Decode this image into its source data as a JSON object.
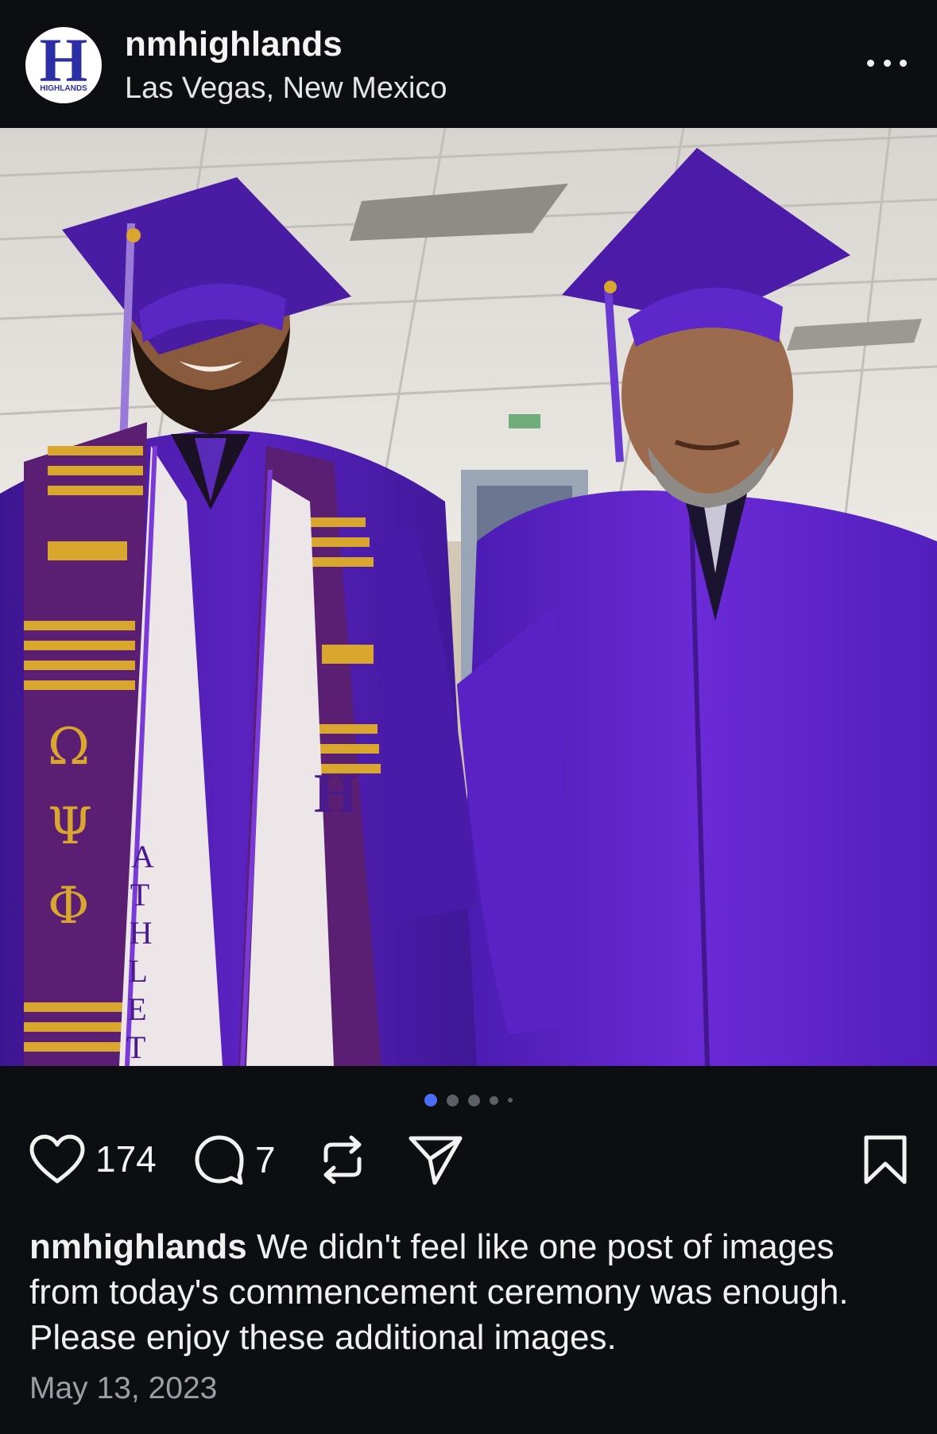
{
  "header": {
    "avatar_letter": "H",
    "avatar_text": "HIGHLANDS",
    "username": "nmhighlands",
    "location": "Las Vegas, New Mexico"
  },
  "photo": {
    "stole_text": "ATHLET",
    "greek_letters": [
      "Ω",
      "Ψ",
      "Φ"
    ],
    "robe_color": "#5a1fb8",
    "stripe_color": "#d9a62e"
  },
  "carousel": {
    "count": 5,
    "active_index": 0,
    "active_color": "#4a6cf7"
  },
  "actions": {
    "likes": "174",
    "comments": "7"
  },
  "caption": {
    "username": "nmhighlands",
    "text": "We didn't feel like one post of images from today's commencement ceremony was enough. Please enjoy these additional images."
  },
  "date": "May 13, 2023"
}
